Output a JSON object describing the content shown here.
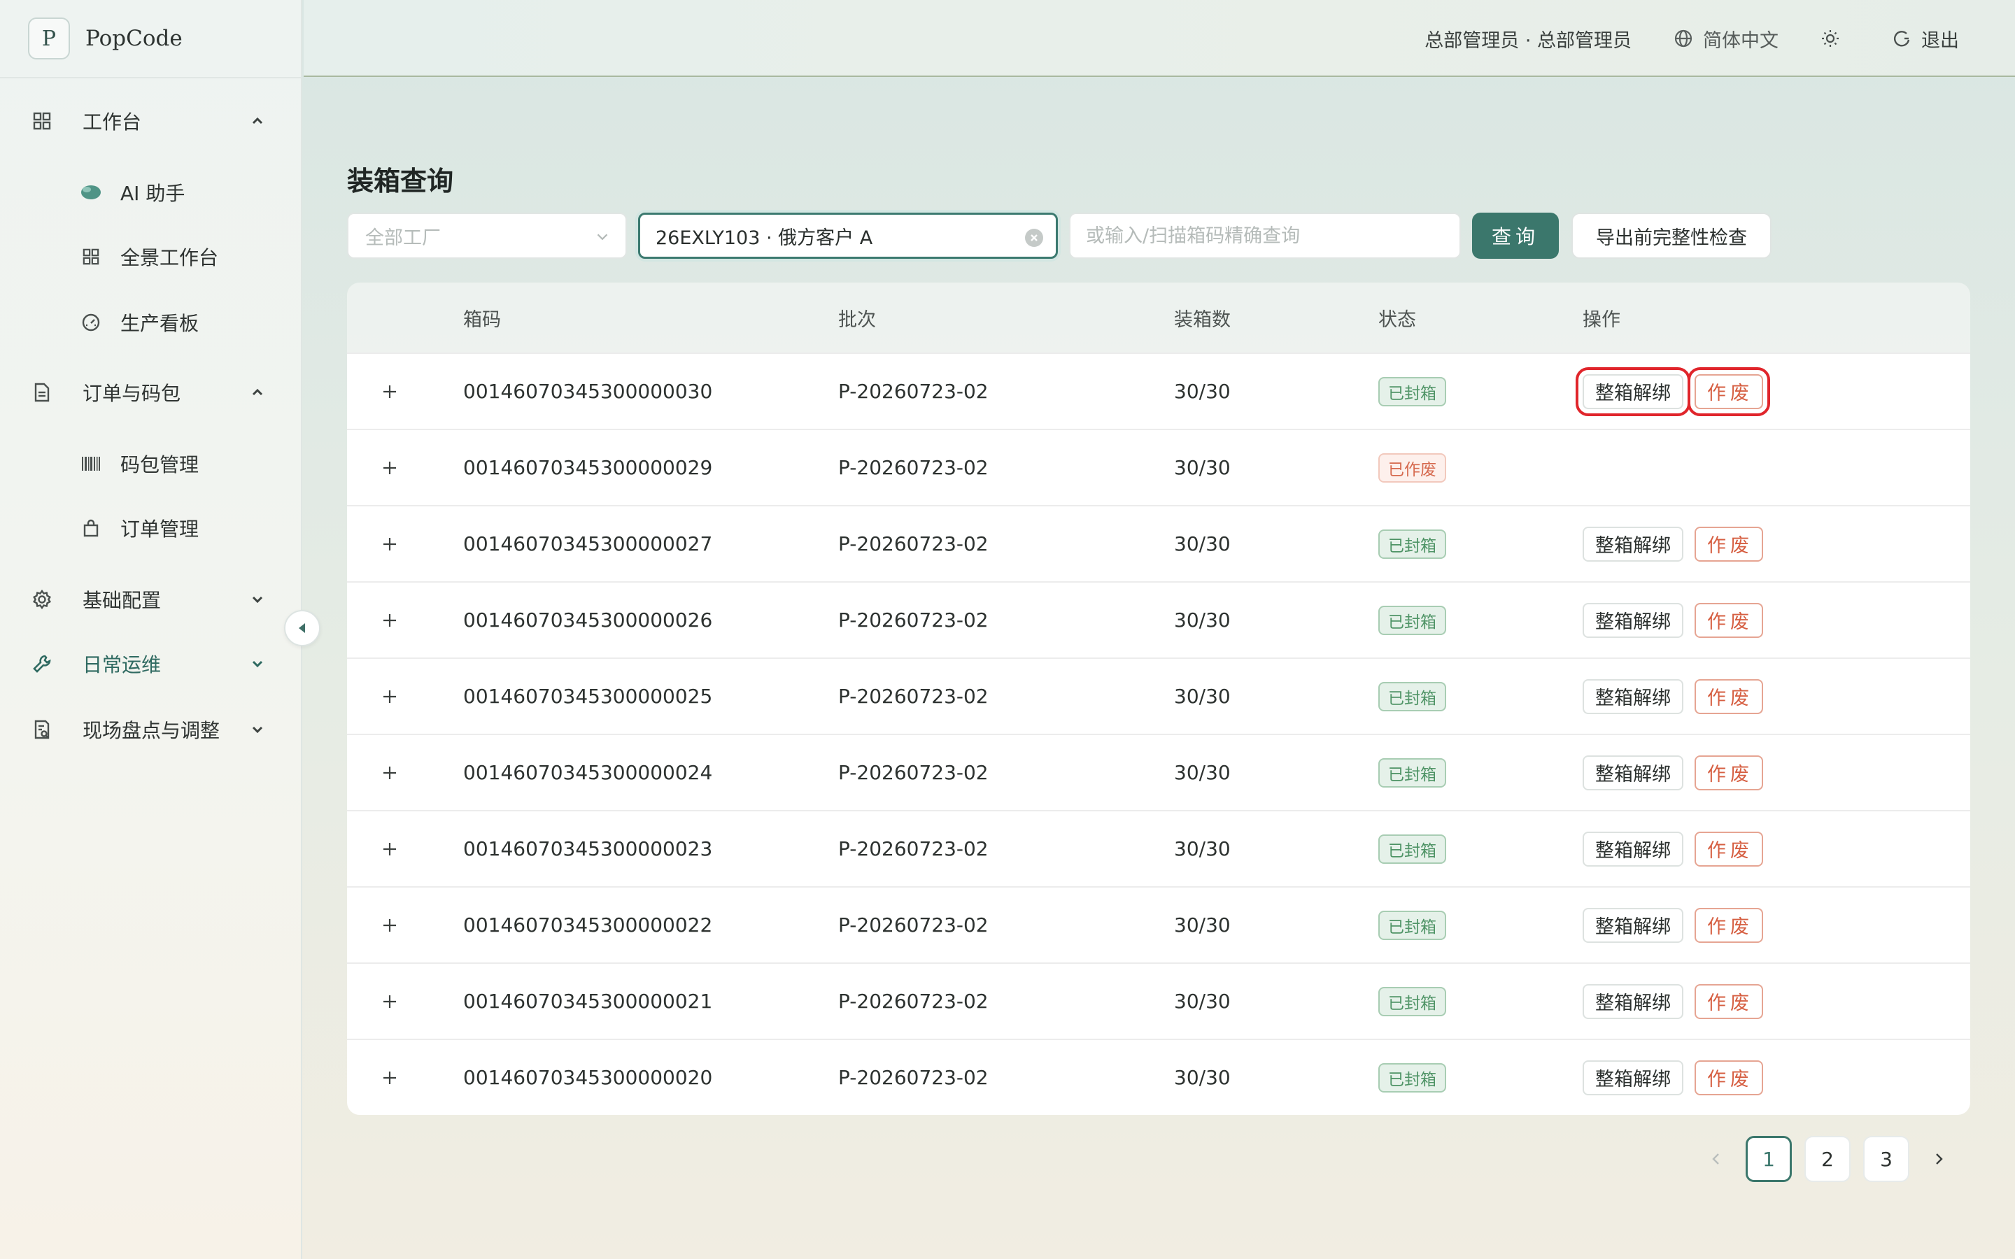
{
  "app": {
    "logo_letter": "P",
    "name": "PopCode"
  },
  "sidebar": {
    "groups": [
      {
        "label": "工作台",
        "expanded": true,
        "items": [
          {
            "label": "AI 助手"
          },
          {
            "label": "全景工作台"
          },
          {
            "label": "生产看板"
          }
        ]
      },
      {
        "label": "订单与码包",
        "expanded": true,
        "items": [
          {
            "label": "码包管理"
          },
          {
            "label": "订单管理"
          }
        ]
      },
      {
        "label": "基础配置",
        "expanded": false
      },
      {
        "label": "日常运维",
        "expanded": false
      },
      {
        "label": "现场盘点与调整",
        "expanded": false
      }
    ]
  },
  "header": {
    "user": "总部管理员 · 总部管理员",
    "language": "简体中文",
    "logout": "退出"
  },
  "page": {
    "title": "装箱查询"
  },
  "filters": {
    "factory_placeholder": "全部工厂",
    "batch_value": "26EXLY103 · 俄方客户 A",
    "box_placeholder": "或输入/扫描箱码精确查询",
    "query_button": "查询",
    "export_button": "导出前完整性检查"
  },
  "table": {
    "headers": {
      "code": "箱码",
      "batch": "批次",
      "qty": "装箱数",
      "status": "状态",
      "ops": "操作"
    },
    "op_unbind": "整箱解绑",
    "op_void": "作废",
    "rows": [
      {
        "code": "00146070345300000030",
        "batch": "P-20260723-02",
        "qty": "30/30",
        "status": "已封箱"
      },
      {
        "code": "00146070345300000029",
        "batch": "P-20260723-02",
        "qty": "30/30",
        "status": "已作废"
      },
      {
        "code": "00146070345300000027",
        "batch": "P-20260723-02",
        "qty": "30/30",
        "status": "已封箱"
      },
      {
        "code": "00146070345300000026",
        "batch": "P-20260723-02",
        "qty": "30/30",
        "status": "已封箱"
      },
      {
        "code": "00146070345300000025",
        "batch": "P-20260723-02",
        "qty": "30/30",
        "status": "已封箱"
      },
      {
        "code": "00146070345300000024",
        "batch": "P-20260723-02",
        "qty": "30/30",
        "status": "已封箱"
      },
      {
        "code": "00146070345300000023",
        "batch": "P-20260723-02",
        "qty": "30/30",
        "status": "已封箱"
      },
      {
        "code": "00146070345300000022",
        "batch": "P-20260723-02",
        "qty": "30/30",
        "status": "已封箱"
      },
      {
        "code": "00146070345300000021",
        "batch": "P-20260723-02",
        "qty": "30/30",
        "status": "已封箱"
      },
      {
        "code": "00146070345300000020",
        "batch": "P-20260723-02",
        "qty": "30/30",
        "status": "已封箱"
      }
    ]
  },
  "pagination": {
    "pages": [
      "1",
      "2",
      "3"
    ],
    "current": "1"
  },
  "colors": {
    "accent": "#3b776c",
    "sealed": "#4f9466",
    "void": "#d65f42",
    "highlight": "#e0252b"
  }
}
